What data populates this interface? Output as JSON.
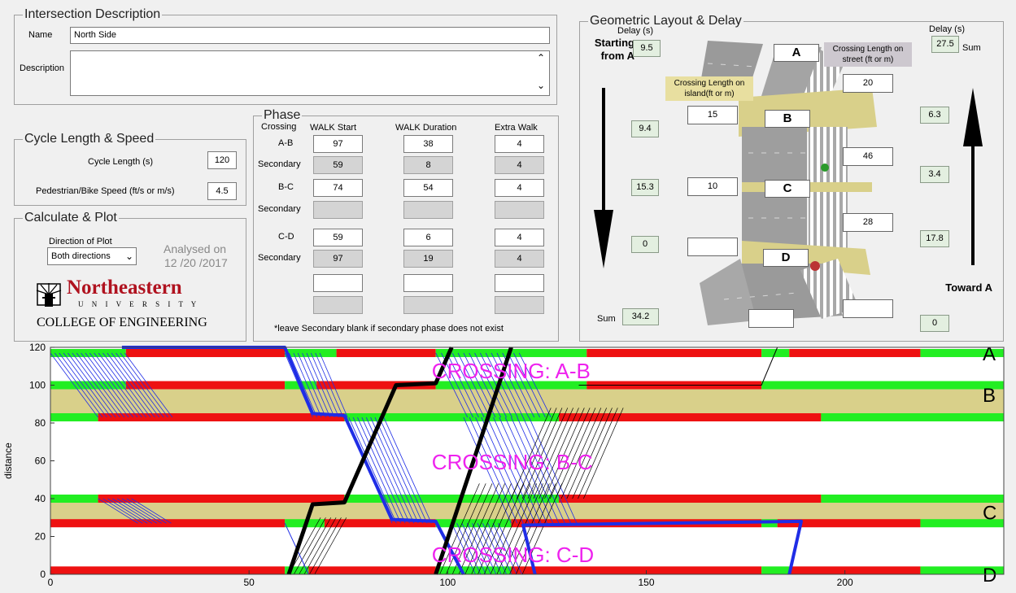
{
  "intersection": {
    "legend": "Intersection Description",
    "name_label": "Name",
    "name_value": "North Side",
    "description_label": "Description",
    "description_value": ""
  },
  "cycle": {
    "legend": "Cycle Length & Speed",
    "cycle_label": "Cycle Length (s)",
    "cycle_value": "120",
    "speed_label": "Pedestrian/Bike Speed (ft/s or m/s)",
    "speed_value": "4.5"
  },
  "calc": {
    "legend": "Calculate & Plot",
    "direction_label": "Direction of Plot",
    "direction_value": "Both directions",
    "analysed_label": "Analysed on",
    "analysed_date": "12 /20  /2017",
    "logo_name": "Northeastern",
    "logo_university": "U N I V E R S I T Y",
    "logo_college": "COLLEGE OF ENGINEERING"
  },
  "phase": {
    "legend": "Phase",
    "col_crossing": "Crossing",
    "col_walk_start": "WALK Start",
    "col_walk_duration": "WALK Duration",
    "col_extra_walk": "Extra Walk",
    "rows": [
      {
        "label": "A-B",
        "start": "97",
        "duration": "38",
        "extra": "4",
        "secondary": false
      },
      {
        "label": "Secondary",
        "start": "59",
        "duration": "8",
        "extra": "4",
        "secondary": true
      },
      {
        "label": "B-C",
        "start": "74",
        "duration": "54",
        "extra": "4",
        "secondary": false
      },
      {
        "label": "Secondary",
        "start": "",
        "duration": "",
        "extra": "",
        "secondary": true
      },
      {
        "label": "C-D",
        "start": "59",
        "duration": "6",
        "extra": "4",
        "secondary": false
      },
      {
        "label": "Secondary",
        "start": "97",
        "duration": "19",
        "extra": "4",
        "secondary": true
      },
      {
        "label": "",
        "start": "",
        "duration": "",
        "extra": "",
        "secondary": false
      },
      {
        "label": "",
        "start": "",
        "duration": "",
        "extra": "",
        "secondary": true
      }
    ],
    "note": "*leave Secondary blank if secondary phase does not exist"
  },
  "geometry": {
    "legend": "Geometric Layout & Delay",
    "delay_left_header": "Delay (s)",
    "delay_right_header": "Delay (s)",
    "starting_from": "Starting from A",
    "toward": "Toward A",
    "sum_label_left": "Sum",
    "sum_label_right": "Sum",
    "left_delays": [
      "9.5",
      "9.4",
      "15.3",
      "0"
    ],
    "left_sum": "34.2",
    "right_sum": "27.5",
    "right_delays": [
      "6.3",
      "3.4",
      "17.8",
      "0"
    ],
    "crossing_street_label": "Crossing Length on street (ft or m)",
    "crossing_island_label": "Crossing Length on island(ft or m)",
    "street_lengths": [
      "20",
      "46",
      "28",
      ""
    ],
    "island_lengths": [
      "15",
      "10",
      ""
    ],
    "node_labels": [
      "A",
      "B",
      "C",
      "D"
    ]
  },
  "colors": {
    "green": "#22ee22",
    "red": "#ee1111",
    "island": "#d9d08a",
    "forward": "#1f2de6",
    "backward": "#000000",
    "annotation": "#ee22ee"
  },
  "chart_data": {
    "type": "line",
    "ylabel": "distance",
    "xlabel": "",
    "xlim": [
      0,
      240
    ],
    "ylim": [
      0,
      120
    ],
    "xticks": [
      0,
      50,
      100,
      150,
      200
    ],
    "yticks": [
      0,
      20,
      40,
      60,
      80,
      100,
      120
    ],
    "node_labels": [
      {
        "name": "A",
        "y": 117
      },
      {
        "name": "B",
        "y": 95
      },
      {
        "name": "C",
        "y": 33
      },
      {
        "name": "D",
        "y": 0
      }
    ],
    "annotations": [
      {
        "text": "CROSSING: A-B",
        "x": 96,
        "y": 107
      },
      {
        "text": "CROSSING: B-C",
        "x": 96,
        "y": 59
      },
      {
        "text": "CROSSING: C-D",
        "x": 96,
        "y": 10
      }
    ],
    "islands": [
      [
        83,
        100
      ],
      [
        27,
        40
      ]
    ],
    "signal_bands": [
      {
        "name": "A",
        "y": 117,
        "segments": [
          [
            0,
            19,
            "green"
          ],
          [
            19,
            59,
            "red"
          ],
          [
            59,
            72,
            "green"
          ],
          [
            72,
            97,
            "red"
          ],
          [
            97,
            135,
            "green"
          ],
          [
            135,
            179,
            "red"
          ],
          [
            179,
            186,
            "green"
          ],
          [
            186,
            219,
            "red"
          ],
          [
            219,
            240,
            "green"
          ]
        ]
      },
      {
        "name": "B-top",
        "y": 100,
        "segments": [
          [
            0,
            19,
            "green"
          ],
          [
            19,
            59,
            "red"
          ],
          [
            59,
            67,
            "green"
          ],
          [
            67,
            97,
            "red"
          ],
          [
            97,
            135,
            "green"
          ],
          [
            135,
            179,
            "red"
          ],
          [
            179,
            240,
            "green"
          ]
        ]
      },
      {
        "name": "B-bottom",
        "y": 83,
        "segments": [
          [
            0,
            12,
            "green"
          ],
          [
            12,
            74,
            "red"
          ],
          [
            74,
            128,
            "green"
          ],
          [
            128,
            194,
            "red"
          ],
          [
            194,
            240,
            "green"
          ]
        ]
      },
      {
        "name": "C-top",
        "y": 40,
        "segments": [
          [
            0,
            12,
            "green"
          ],
          [
            12,
            74,
            "red"
          ],
          [
            74,
            128,
            "green"
          ],
          [
            128,
            194,
            "red"
          ],
          [
            194,
            240,
            "green"
          ]
        ]
      },
      {
        "name": "C-bottom",
        "y": 27,
        "segments": [
          [
            0,
            59,
            "red"
          ],
          [
            59,
            69,
            "green"
          ],
          [
            69,
            97,
            "red"
          ],
          [
            97,
            116,
            "green"
          ],
          [
            116,
            179,
            "red"
          ],
          [
            179,
            183,
            "green"
          ],
          [
            183,
            219,
            "red"
          ],
          [
            219,
            240,
            "green"
          ]
        ]
      },
      {
        "name": "D",
        "y": 2,
        "segments": [
          [
            0,
            59,
            "red"
          ],
          [
            59,
            65,
            "green"
          ],
          [
            65,
            97,
            "red"
          ],
          [
            97,
            116,
            "green"
          ],
          [
            116,
            179,
            "red"
          ],
          [
            179,
            186,
            "green"
          ],
          [
            186,
            219,
            "red"
          ],
          [
            219,
            240,
            "green"
          ]
        ]
      }
    ],
    "series": [
      {
        "name": "",
        "color": "forward",
        "points": [
          [
            18,
            120
          ],
          [
            59,
            120
          ],
          [
            66,
            85
          ],
          [
            74,
            84
          ],
          [
            86,
            29
          ],
          [
            97,
            28
          ],
          [
            104,
            0
          ]
        ]
      },
      {
        "name": "",
        "color": "forward",
        "points": [
          [
            122,
            0
          ],
          [
            119,
            26
          ],
          [
            189,
            28
          ],
          [
            186,
            0
          ]
        ]
      },
      {
        "name": "",
        "color": "backward",
        "points": [
          [
            60,
            0
          ],
          [
            66,
            37
          ],
          [
            74,
            38
          ],
          [
            87,
            100
          ],
          [
            97,
            101
          ],
          [
            101,
            120
          ]
        ]
      },
      {
        "name": "",
        "color": "backward",
        "points": [
          [
            97,
            0
          ],
          [
            116,
            120
          ]
        ]
      }
    ]
  }
}
